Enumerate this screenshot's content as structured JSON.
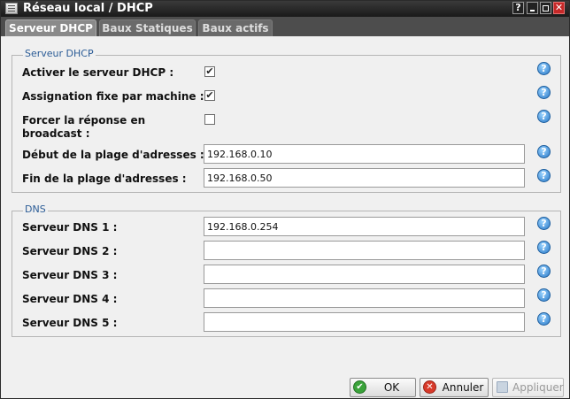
{
  "window": {
    "title": "Réseau local / DHCP",
    "help_glyph": "?",
    "close_glyph": "✕"
  },
  "tabs": [
    {
      "label": "Serveur DHCP",
      "selected": true
    },
    {
      "label": "Baux Statiques",
      "selected": false
    },
    {
      "label": "Baux actifs",
      "selected": false
    }
  ],
  "dhcp_section": {
    "legend": "Serveur DHCP",
    "enable_label": "Activer le serveur DHCP :",
    "enable_checked": true,
    "fixed_label": "Assignation fixe par machine :",
    "fixed_checked": true,
    "broadcast_label_line1": "Forcer la réponse en",
    "broadcast_label_line2": "broadcast :",
    "broadcast_checked": false,
    "range_start_label": "Début de la plage d'adresses :",
    "range_start_value": "192.168.0.10",
    "range_end_label": "Fin de la plage d'adresses :",
    "range_end_value": "192.168.0.50"
  },
  "dns_section": {
    "legend": "DNS",
    "servers": [
      {
        "label": "Serveur DNS 1 :",
        "value": "192.168.0.254"
      },
      {
        "label": "Serveur DNS 2 :",
        "value": ""
      },
      {
        "label": "Serveur DNS 3 :",
        "value": ""
      },
      {
        "label": "Serveur DNS 4 :",
        "value": ""
      },
      {
        "label": "Serveur DNS 5 :",
        "value": ""
      }
    ]
  },
  "help_icon_glyph": "?",
  "checkmark_glyph": "✔",
  "buttons": {
    "ok": "OK",
    "cancel": "Annuler",
    "apply": "Appliquer",
    "ok_icon": "✔",
    "cancel_icon": "✕"
  },
  "colors": {
    "titlebar": "#1a1a1a",
    "tabbar": "#4d4d4d",
    "legend_text": "#2b5c96",
    "help_icon": "#2a79c8"
  }
}
